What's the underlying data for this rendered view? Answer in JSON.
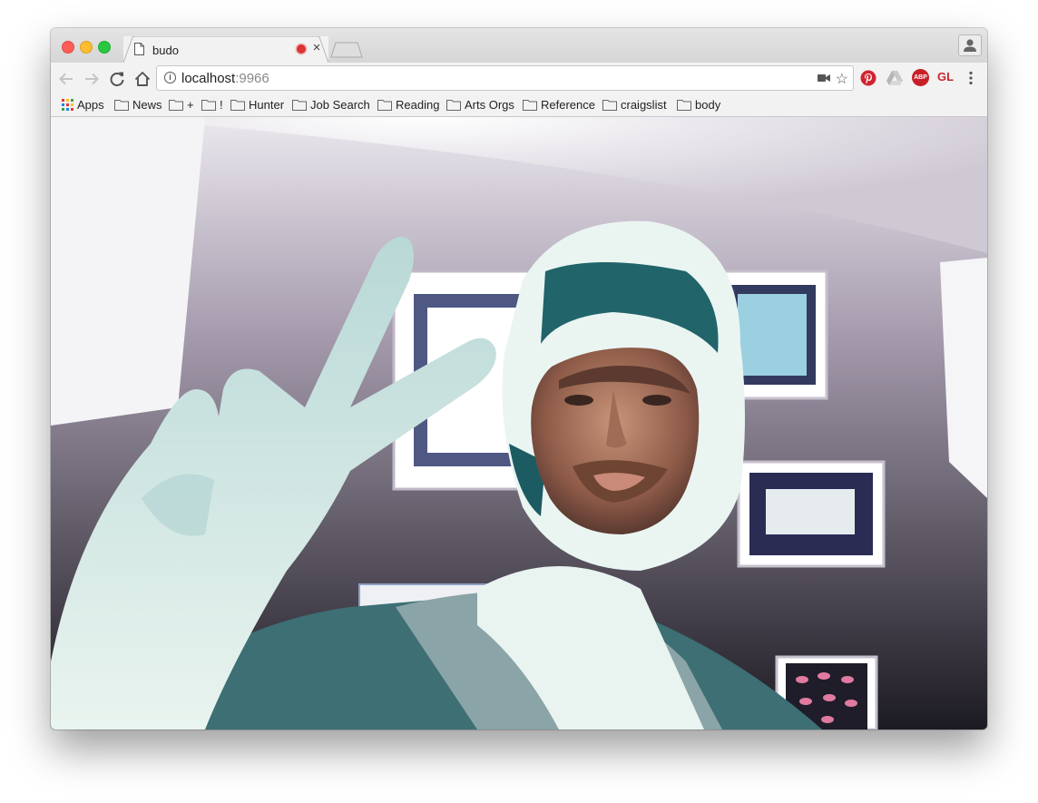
{
  "browser": {
    "tab": {
      "title": "budo",
      "close_label": "×"
    },
    "address_bar": {
      "host": "localhost",
      "port": ":9966"
    },
    "extensions": {
      "gl_label": "GL",
      "abp_label": "ABP"
    },
    "star_glyph": "☆"
  },
  "bookmarks": [
    {
      "label": "Apps",
      "icon": "apps-grid-icon"
    },
    {
      "label": "News",
      "icon": "folder-icon"
    },
    {
      "label": "+",
      "icon": "folder-icon"
    },
    {
      "label": "!",
      "icon": "folder-icon"
    },
    {
      "label": "Hunter",
      "icon": "folder-icon"
    },
    {
      "label": "Job Search",
      "icon": "folder-icon"
    },
    {
      "label": "Reading",
      "icon": "folder-icon"
    },
    {
      "label": "Arts Orgs",
      "icon": "folder-icon"
    },
    {
      "label": "Reference",
      "icon": "folder-icon"
    },
    {
      "label": "craigslist",
      "icon": "folder-icon"
    },
    {
      "label": "body",
      "icon": "folder-icon"
    }
  ],
  "content": {
    "description_icon": "webcam-video-feed"
  },
  "colors": {
    "close": "#fc5f57",
    "minimize": "#fdbc2e",
    "maximize": "#29c840",
    "pinterest": "#d0252f",
    "abp": "#c62026",
    "gl": "#c8272d"
  }
}
